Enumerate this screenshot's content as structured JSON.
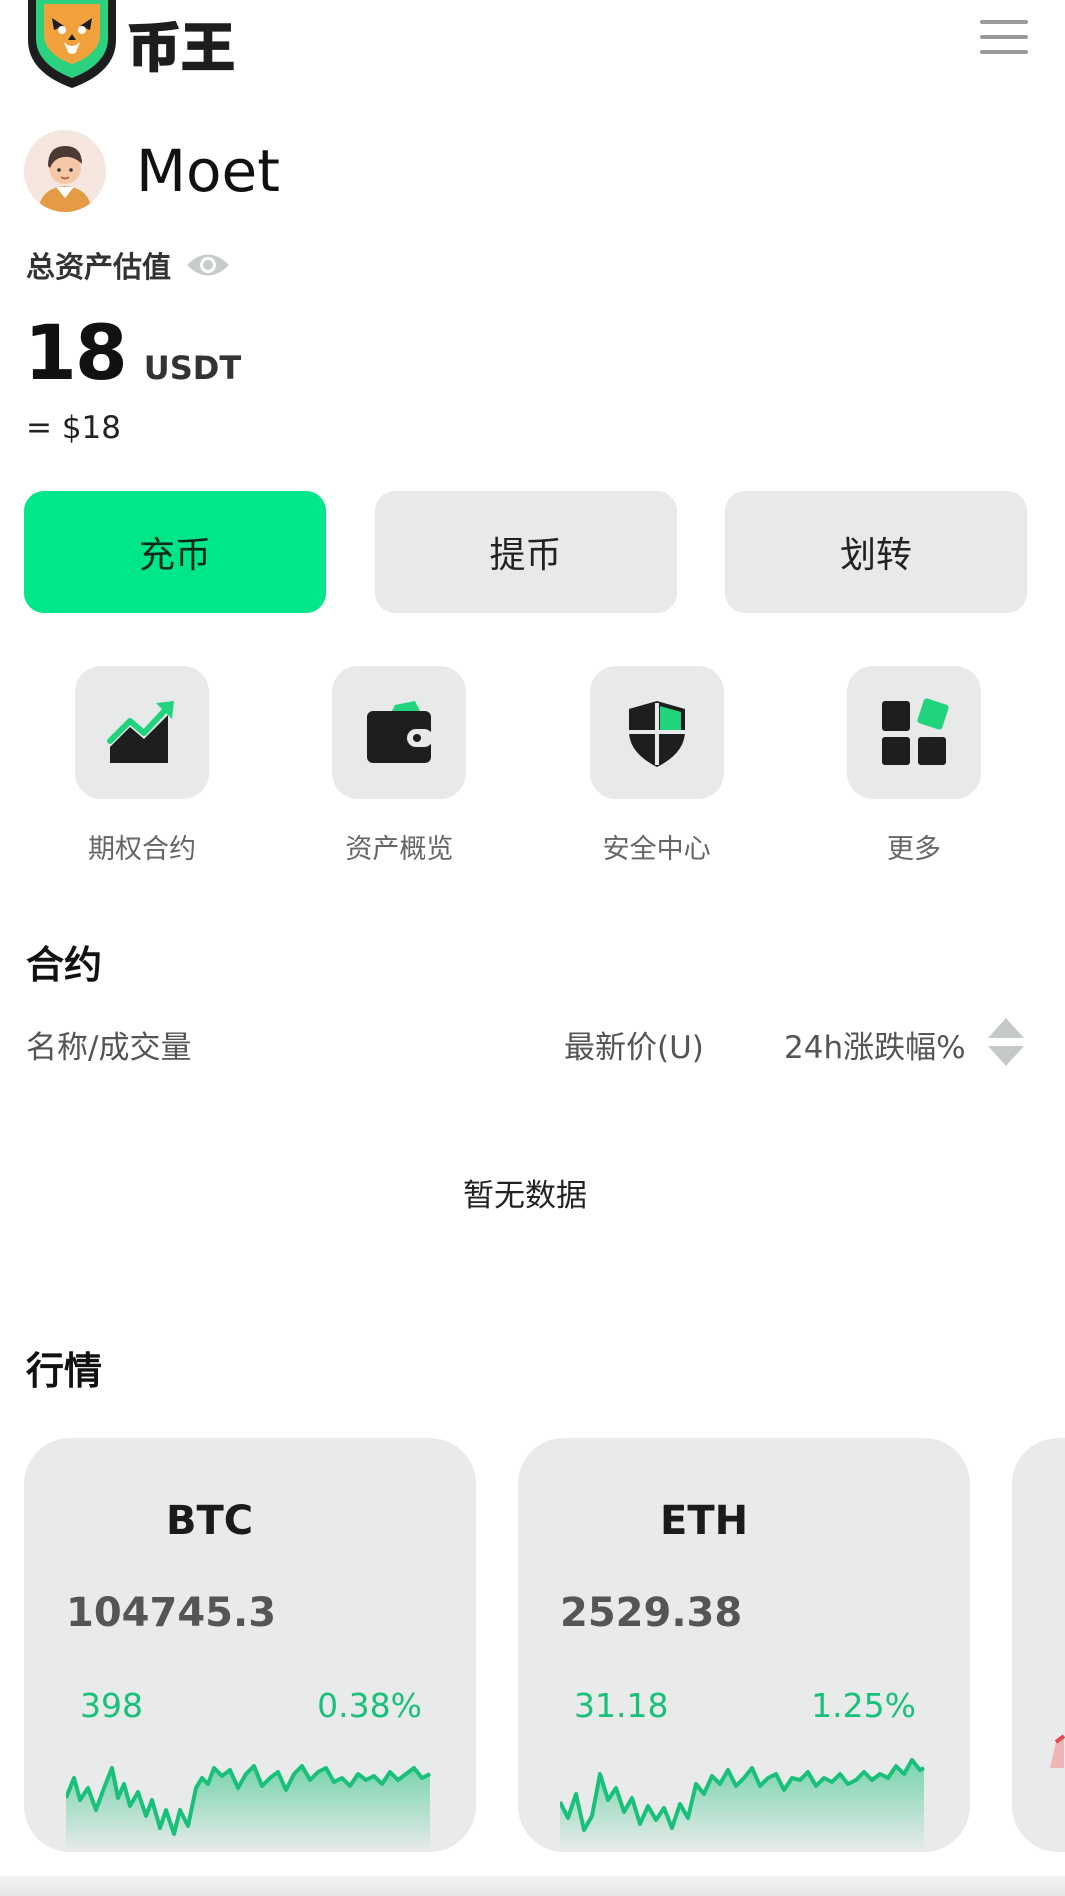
{
  "header": {
    "brand_text": "币王",
    "menu_icon": "hamburger-menu-icon"
  },
  "profile": {
    "username": "Moet",
    "avatar_icon": "user-avatar"
  },
  "assets": {
    "label": "总资产估值",
    "visibility_icon": "eye-icon",
    "balance": "18",
    "unit": "USDT",
    "fiat_value": "= $18"
  },
  "actions": [
    {
      "label": "充币",
      "primary": true
    },
    {
      "label": "提币",
      "primary": false
    },
    {
      "label": "划转",
      "primary": false
    }
  ],
  "shortcuts": [
    {
      "label": "期权合约",
      "icon": "trend-chart-icon"
    },
    {
      "label": "资产概览",
      "icon": "wallet-icon"
    },
    {
      "label": "安全中心",
      "icon": "shield-icon"
    },
    {
      "label": "更多",
      "icon": "grid-more-icon"
    }
  ],
  "contracts": {
    "title": "合约",
    "col_name": "名称/成交量",
    "col_price": "最新价(U)",
    "col_change": "24h涨跌幅%",
    "empty_text": "暂无数据"
  },
  "market": {
    "title": "行情",
    "cards": [
      {
        "name": "BTC",
        "price": "104745.3",
        "change": "398",
        "percent": "0.38%"
      },
      {
        "name": "ETH",
        "price": "2529.38",
        "change": "31.18",
        "percent": "1.25%"
      }
    ]
  },
  "colors": {
    "accent": "#00e78a",
    "rise": "#19c07a",
    "card_bg": "#e9ebeb"
  }
}
